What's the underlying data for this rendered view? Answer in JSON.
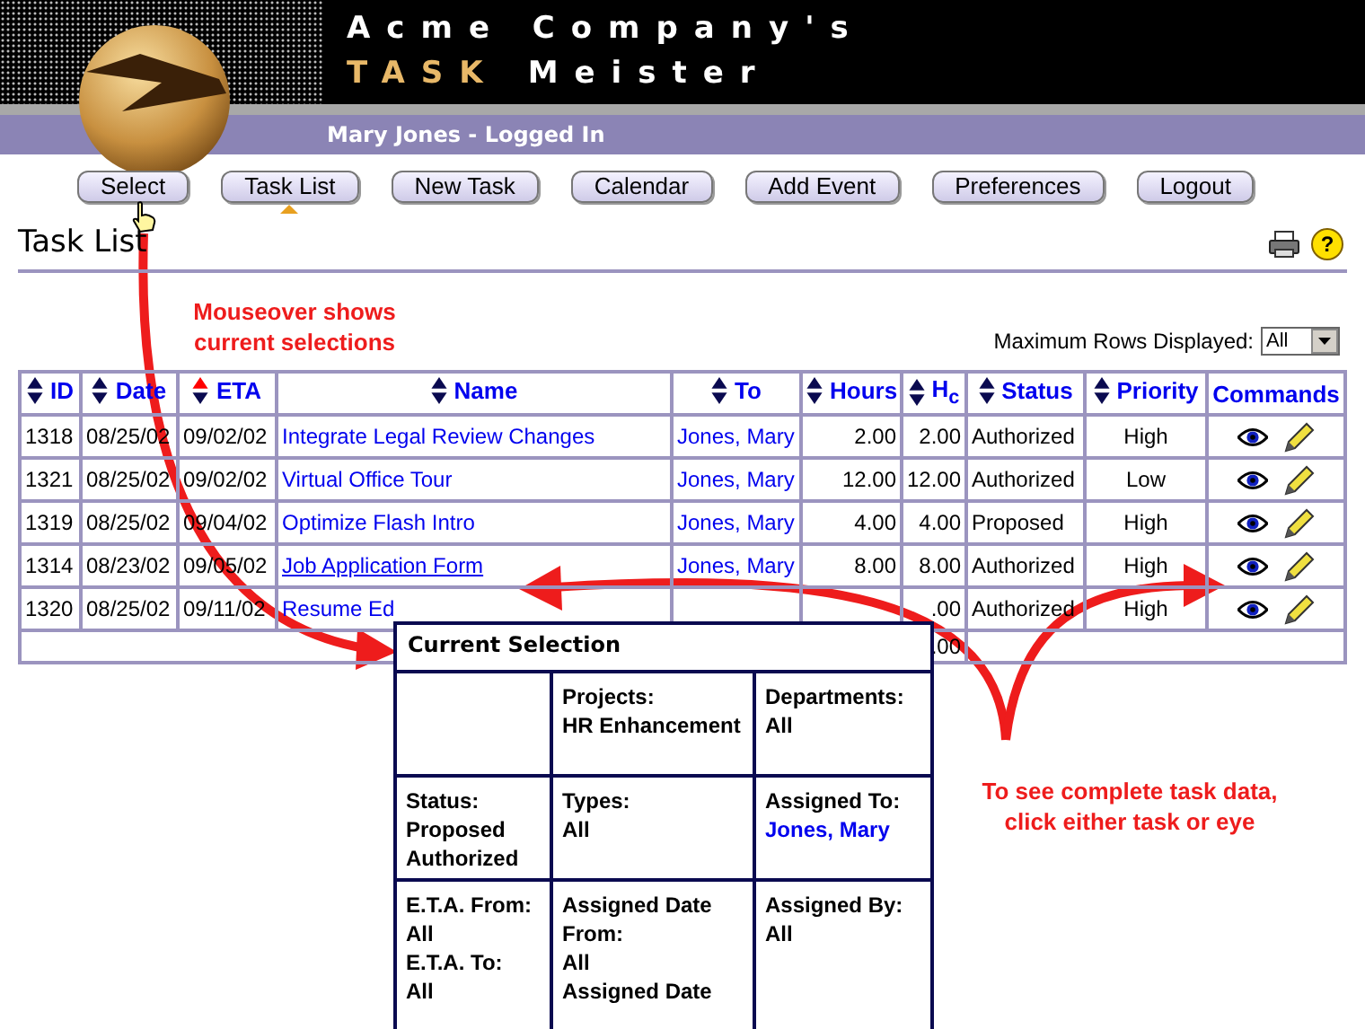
{
  "header": {
    "company": "Acme Company's",
    "product_first": "TASK",
    "product_second": "Meister",
    "user_status": "Mary Jones - Logged In"
  },
  "nav": [
    {
      "label": "Select",
      "selected": false
    },
    {
      "label": "Task List",
      "selected": true
    },
    {
      "label": "New Task",
      "selected": false
    },
    {
      "label": "Calendar",
      "selected": false
    },
    {
      "label": "Add Event",
      "selected": false
    },
    {
      "label": "Preferences",
      "selected": false
    },
    {
      "label": "Logout",
      "selected": false
    }
  ],
  "page": {
    "title": "Task List",
    "help": "?"
  },
  "max_rows": {
    "label": "Maximum Rows Displayed:",
    "value": "All"
  },
  "table": {
    "columns": [
      {
        "label": "ID",
        "sortable": true,
        "sorted": false
      },
      {
        "label": "Date",
        "sortable": true,
        "sorted": false
      },
      {
        "label": "ETA",
        "sortable": true,
        "sorted": true
      },
      {
        "label": "Name",
        "sortable": true,
        "sorted": false
      },
      {
        "label": "To",
        "sortable": true,
        "sorted": false
      },
      {
        "label": "Hours",
        "sortable": true,
        "sorted": false
      },
      {
        "label": "H$_{c}$",
        "sortable": true,
        "sorted": false
      },
      {
        "label": "Status",
        "sortable": true,
        "sorted": false
      },
      {
        "label": "Priority",
        "sortable": true,
        "sorted": false
      },
      {
        "label": "Commands",
        "sortable": false
      }
    ],
    "rows": [
      {
        "id": "1318",
        "date": "08/25/02",
        "eta": "09/02/02",
        "name": "Integrate Legal Review Changes",
        "to": "Jones, Mary",
        "hours": "2.00",
        "hc": "2.00",
        "status": "Authorized",
        "priority": "High",
        "hovered": false
      },
      {
        "id": "1321",
        "date": "08/25/02",
        "eta": "09/02/02",
        "name": "Virtual Office Tour",
        "to": "Jones, Mary",
        "hours": "12.00",
        "hc": "12.00",
        "status": "Authorized",
        "priority": "Low",
        "hovered": false
      },
      {
        "id": "1319",
        "date": "08/25/02",
        "eta": "09/04/02",
        "name": "Optimize Flash Intro",
        "to": "Jones, Mary",
        "hours": "4.00",
        "hc": "4.00",
        "status": "Proposed",
        "priority": "High",
        "hovered": false
      },
      {
        "id": "1314",
        "date": "08/23/02",
        "eta": "09/05/02",
        "name": "Job Application Form",
        "to": "Jones, Mary",
        "hours": "8.00",
        "hc": "8.00",
        "status": "Authorized",
        "priority": "High",
        "hovered": true
      },
      {
        "id": "1320",
        "date": "08/25/02",
        "eta": "09/11/02",
        "name": "Resume Ed",
        "hc": ".00",
        "status": "Authorized",
        "priority": "High",
        "hovered": false
      }
    ],
    "total": {
      "hc": ".00"
    }
  },
  "selection_popup": {
    "title": "Current Selection",
    "cells": [
      {
        "kind": "blank"
      },
      {
        "kind": "filter",
        "items": [
          {
            "text": "Projects:",
            "link": false
          },
          {
            "text": "HR Enhancement",
            "link": false
          }
        ]
      },
      {
        "kind": "filter",
        "items": [
          {
            "text": "Departments:",
            "link": false
          },
          {
            "text": "All",
            "link": false
          }
        ]
      },
      {
        "kind": "filter",
        "items": [
          {
            "text": "Status:",
            "link": false
          },
          {
            "text": "Proposed",
            "link": false
          },
          {
            "text": "Authorized",
            "link": false
          }
        ]
      },
      {
        "kind": "filter",
        "items": [
          {
            "text": "Types:",
            "link": false
          },
          {
            "text": "All",
            "link": false
          }
        ]
      },
      {
        "kind": "filter",
        "items": [
          {
            "text": "Assigned To:",
            "link": false
          },
          {
            "text": "Jones, Mary",
            "link": true
          }
        ]
      },
      {
        "kind": "filter",
        "items": [
          {
            "text": "E.T.A. From:",
            "link": false
          },
          {
            "text": "All",
            "link": false
          },
          {
            "text": "E.T.A. To:",
            "link": false
          },
          {
            "text": "All",
            "link": false
          }
        ]
      },
      {
        "kind": "filter",
        "items": [
          {
            "text": "Assigned Date From:",
            "link": false
          },
          {
            "text": "All",
            "link": false
          },
          {
            "text": "Assigned Date",
            "link": false
          }
        ]
      },
      {
        "kind": "filter",
        "items": [
          {
            "text": "Assigned By:",
            "link": false
          },
          {
            "text": "All",
            "link": false
          }
        ]
      }
    ]
  },
  "annotations": [
    {
      "text": "Mouseover shows current selections"
    },
    {
      "text": "To see complete task data, click either task or eye"
    }
  ]
}
